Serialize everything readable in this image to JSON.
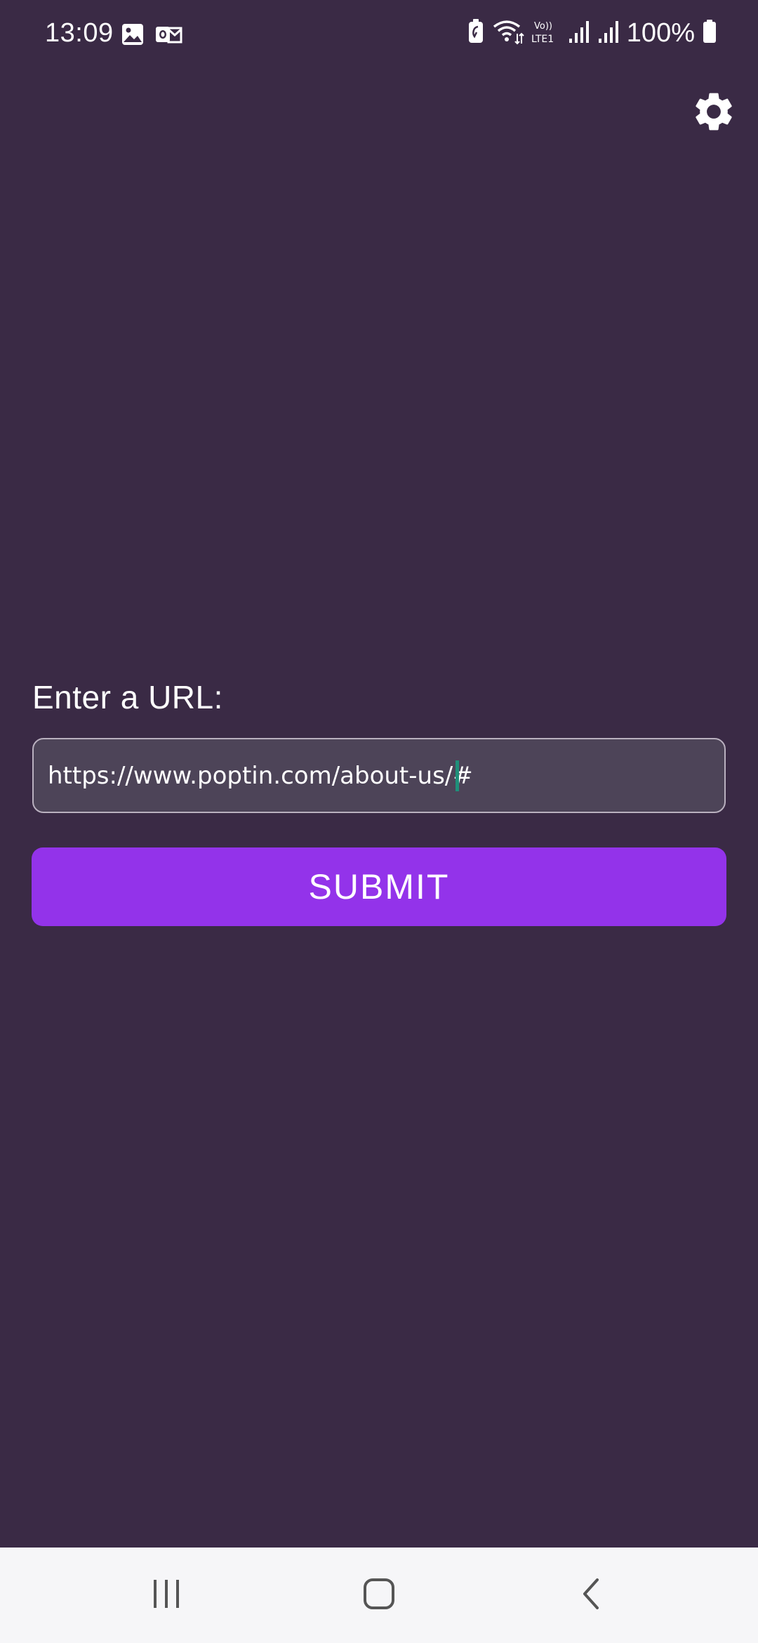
{
  "status_bar": {
    "time": "13:09",
    "battery_text": "100%",
    "left_icons": [
      "image-icon",
      "outlook-icon"
    ],
    "right_icons": [
      "battery-saver-icon",
      "wifi-icon",
      "volte-lte-icon",
      "signal-1-icon",
      "signal-2-icon",
      "battery-icon"
    ]
  },
  "header": {
    "settings_icon": "gear-icon"
  },
  "form": {
    "label": "Enter a URL:",
    "url_value": "https://www.poptin.com/about-us/#",
    "submit_label": "SUBMIT"
  },
  "colors": {
    "background": "#3a2a45",
    "input_background": "#4d4458",
    "input_border": "#b9b0bf",
    "submit_button": "#9333ea",
    "cursor": "#1f8f7a",
    "nav_bar": "#f6f6f8"
  },
  "nav_bar": {
    "buttons": [
      "recent-apps-icon",
      "home-icon",
      "back-icon"
    ]
  }
}
